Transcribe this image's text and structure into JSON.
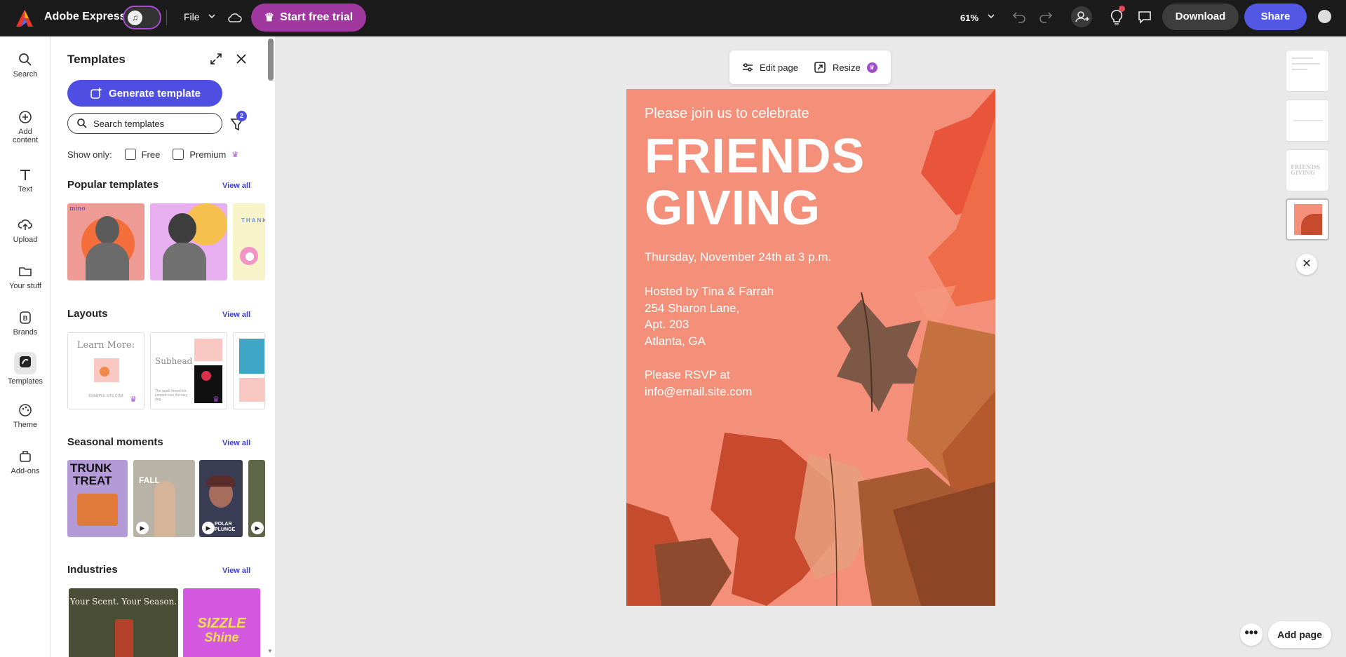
{
  "header": {
    "app_title": "Adobe Express",
    "file_menu": "File",
    "start_trial": "Start free trial",
    "zoom": "61%",
    "download": "Download",
    "share": "Share"
  },
  "rail": {
    "items": [
      {
        "label": "Search",
        "icon": "search-icon"
      },
      {
        "label": "Add\ncontent",
        "icon": "plus-circle-icon"
      },
      {
        "label": "Text",
        "icon": "text-icon"
      },
      {
        "label": "Upload",
        "icon": "upload-icon"
      },
      {
        "label": "Your stuff",
        "icon": "folder-icon"
      },
      {
        "label": "Brands",
        "icon": "brand-icon"
      },
      {
        "label": "Templates",
        "icon": "templates-icon"
      },
      {
        "label": "Theme",
        "icon": "palette-icon"
      },
      {
        "label": "Add-ons",
        "icon": "addons-icon"
      }
    ]
  },
  "panel": {
    "title": "Templates",
    "generate_button": "Generate template",
    "search_placeholder": "Search templates",
    "filter_count": "2",
    "show_only_label": "Show only:",
    "free_label": "Free",
    "premium_label": "Premium",
    "view_all": "View all",
    "sections": {
      "popular": "Popular templates",
      "layouts": "Layouts",
      "seasonal": "Seasonal moments",
      "industries": "Industries"
    },
    "thumb_texts": {
      "popular_1": "mino",
      "popular_3": "THANK",
      "layout_1": "Learn More:",
      "layout_1_small": "EXAMPLE SITE.COM",
      "layout_2": "Subhead",
      "layout_2_small": "The quick brown fox jumped over the lazy dog.",
      "seasonal_1a": "TRUNK",
      "seasonal_1b": "TREAT",
      "seasonal_2": "FALL",
      "seasonal_3": "POLAR PLUNGE",
      "industry_1": "Your Scent. Your Season.",
      "industry_2a": "SIZZLE",
      "industry_2b": "Shine"
    }
  },
  "page_toolbar": {
    "edit_page": "Edit page",
    "resize": "Resize"
  },
  "poster": {
    "invite": "Please join us to celebrate",
    "title_line1": "FRIENDS",
    "title_line2": "GIVING",
    "date": "Thursday, November 24th at 3 p.m.",
    "host_line1": "Hosted by Tina & Farrah",
    "host_line2": "254 Sharon Lane,",
    "host_line3": "Apt. 203",
    "host_line4": "Atlanta, GA",
    "rsvp_line1": "Please RSVP at",
    "rsvp_line2": "info@email.site.com"
  },
  "pages_thumb_texts": {
    "page3": "FRIENDS GIVING"
  },
  "footer": {
    "add_page": "Add page",
    "more": "•••"
  },
  "colors": {
    "accent": "#4e4fe2",
    "trial": "#a1389f",
    "poster_bg": "#f4907a"
  }
}
